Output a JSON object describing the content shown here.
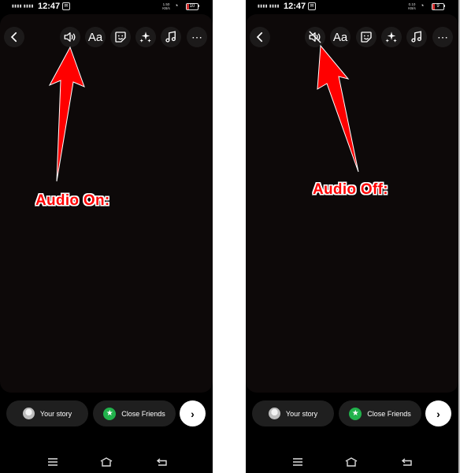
{
  "panels": [
    {
      "status": {
        "time": "12:47",
        "speed": "1.50 KB/s",
        "battery": "10"
      },
      "toolbar": {
        "back": "back-icon",
        "audio": "speaker-on-icon",
        "text_label": "Aa",
        "sticker": "sticker-icon",
        "effects": "sparkles-icon",
        "music": "music-note-icon",
        "more": "⋯"
      },
      "annotation": "Audio On:",
      "bottom": {
        "your_story": "Your story",
        "close_friends": "Close Friends",
        "next": "›"
      }
    },
    {
      "status": {
        "time": "12:47",
        "speed": "0.10 KB/s",
        "battery": "9"
      },
      "toolbar": {
        "back": "back-icon",
        "audio": "speaker-muted-icon",
        "text_label": "Aa",
        "sticker": "sticker-icon",
        "effects": "sparkles-icon",
        "music": "music-note-icon",
        "more": "⋯"
      },
      "annotation": "Audio Off:",
      "bottom": {
        "your_story": "Your story",
        "close_friends": "Close Friends",
        "next": "›"
      }
    }
  ],
  "colors": {
    "annotation": "#ff0000",
    "close_friends_green": "#22b24c",
    "canvas": "#0d0909"
  }
}
